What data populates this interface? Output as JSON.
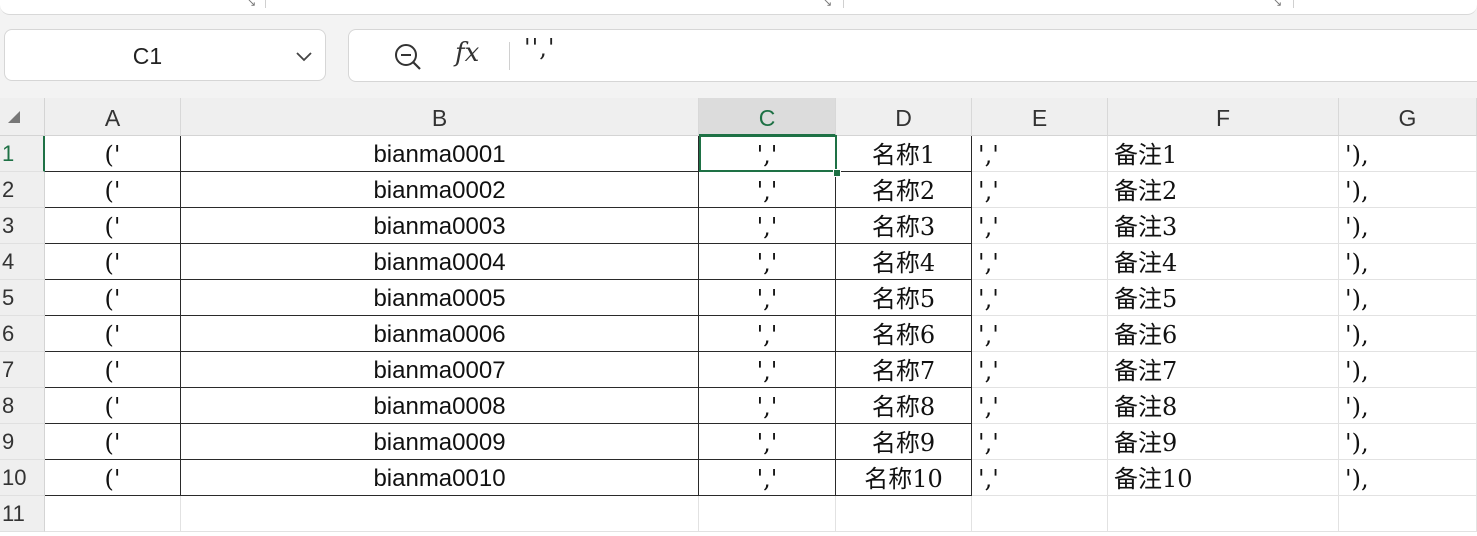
{
  "name_box": {
    "value": "C1"
  },
  "formula_bar": {
    "fx_label": "fx",
    "content": "'','"
  },
  "columns": [
    "A",
    "B",
    "C",
    "D",
    "E",
    "F",
    "G"
  ],
  "selected_cell": "C1",
  "rows": [
    {
      "num": "1",
      "A": "('",
      "B": "bianma0001",
      "C": "','",
      "D": "名称1",
      "E": "','",
      "F": "备注1",
      "G": "'),"
    },
    {
      "num": "2",
      "A": "('",
      "B": "bianma0002",
      "C": "','",
      "D": "名称2",
      "E": "','",
      "F": "备注2",
      "G": "'),"
    },
    {
      "num": "3",
      "A": "('",
      "B": "bianma0003",
      "C": "','",
      "D": "名称3",
      "E": "','",
      "F": "备注3",
      "G": "'),"
    },
    {
      "num": "4",
      "A": "('",
      "B": "bianma0004",
      "C": "','",
      "D": "名称4",
      "E": "','",
      "F": "备注4",
      "G": "'),"
    },
    {
      "num": "5",
      "A": "('",
      "B": "bianma0005",
      "C": "','",
      "D": "名称5",
      "E": "','",
      "F": "备注5",
      "G": "'),"
    },
    {
      "num": "6",
      "A": "('",
      "B": "bianma0006",
      "C": "','",
      "D": "名称6",
      "E": "','",
      "F": "备注6",
      "G": "'),"
    },
    {
      "num": "7",
      "A": "('",
      "B": "bianma0007",
      "C": "','",
      "D": "名称7",
      "E": "','",
      "F": "备注7",
      "G": "'),"
    },
    {
      "num": "8",
      "A": "('",
      "B": "bianma0008",
      "C": "','",
      "D": "名称8",
      "E": "','",
      "F": "备注8",
      "G": "'),"
    },
    {
      "num": "9",
      "A": "('",
      "B": "bianma0009",
      "C": "','",
      "D": "名称9",
      "E": "','",
      "F": "备注9",
      "G": "'),"
    },
    {
      "num": "10",
      "A": "('",
      "B": "bianma0010",
      "C": "','",
      "D": "名称10",
      "E": "','",
      "F": "备注10",
      "G": "'),"
    },
    {
      "num": "11",
      "A": "",
      "B": "",
      "C": "",
      "D": "",
      "E": "",
      "F": "",
      "G": ""
    }
  ],
  "colors": {
    "accent": "#1e7145",
    "header_bg": "#efefef",
    "selected_header_bg": "#dcdcdc"
  }
}
